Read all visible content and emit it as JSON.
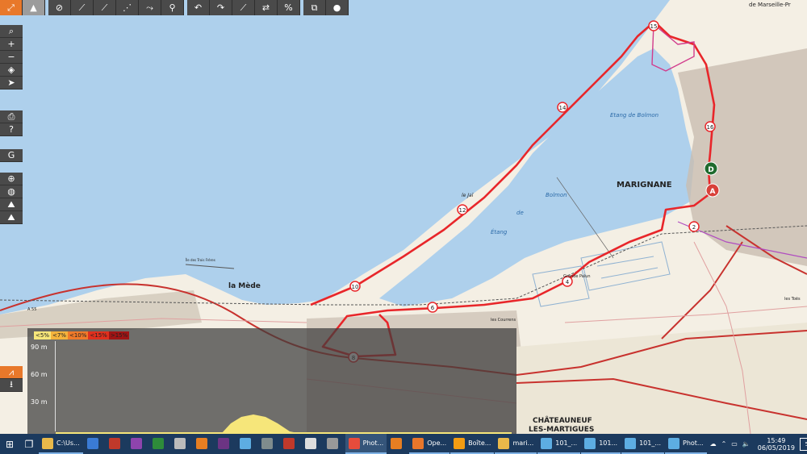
{
  "toolbar": {
    "top_buttons": [
      {
        "name": "fullscreen-icon",
        "glyph": "⤢"
      },
      {
        "name": "map-layer-icon",
        "glyph": "▲"
      },
      {
        "name": "hide-track-icon",
        "glyph": "⊘"
      },
      {
        "name": "draw-line-icon",
        "glyph": "⟋"
      },
      {
        "name": "draw-segment-icon",
        "glyph": "⟋"
      },
      {
        "name": "waypoint-path-icon",
        "glyph": "⋰"
      },
      {
        "name": "route-icon",
        "glyph": "⤳"
      },
      {
        "name": "bike-route-icon",
        "glyph": "⚲"
      },
      {
        "name": "undo-icon",
        "glyph": "↶"
      },
      {
        "name": "redo-icon",
        "glyph": "↷"
      },
      {
        "name": "split-path-icon",
        "glyph": "⟋"
      },
      {
        "name": "reverse-icon",
        "glyph": "⇄"
      },
      {
        "name": "percent-icon",
        "glyph": "%"
      },
      {
        "name": "copy-icon",
        "glyph": "⧉"
      },
      {
        "name": "marker-icon",
        "glyph": "●"
      }
    ],
    "left_groups": [
      [
        {
          "name": "search-icon",
          "glyph": "⌕"
        },
        {
          "name": "zoom-in-icon",
          "glyph": "+"
        },
        {
          "name": "zoom-out-icon",
          "glyph": "−"
        },
        {
          "name": "layers-icon",
          "glyph": "◈"
        },
        {
          "name": "locate-icon",
          "glyph": "➤"
        }
      ],
      [
        {
          "name": "print-icon",
          "glyph": "⎙"
        },
        {
          "name": "help-icon",
          "glyph": "?"
        }
      ],
      [
        {
          "name": "google-icon",
          "glyph": "G"
        }
      ],
      [
        {
          "name": "crosshair-icon",
          "glyph": "⊕"
        },
        {
          "name": "globe-icon",
          "glyph": "◍"
        },
        {
          "name": "terrain-icon",
          "glyph": "⛰"
        },
        {
          "name": "terrain-alt-icon",
          "glyph": "⛰"
        }
      ],
      [
        {
          "name": "elevation-profile-icon",
          "glyph": "⩘"
        },
        {
          "name": "download-icon",
          "glyph": "⭳"
        }
      ]
    ]
  },
  "map": {
    "labels": {
      "marignane": "MARIGNANE",
      "la_mede": "la Mède",
      "chateauneuf_1": "CHÂTEAUNEUF",
      "chateauneuf_2": "LES-MARTIGUES",
      "etang_bolmon_1": "Etang de Bolmon",
      "etang_bolmon_2": "Bolmon",
      "etang_de": "de",
      "etang": "Étang",
      "de_marseille": "de Marseille-Pr",
      "le_jai": "le Jaï",
      "grande_palun": "Grande Palun",
      "courrens": "les Courrens",
      "les_toes": "les Toës",
      "a55": "A 55",
      "ile_trois_freres": "Île des Trois Frères"
    },
    "markers": {
      "start": "D",
      "end": "A"
    },
    "km_markers": [
      "2",
      "4",
      "6",
      "8",
      "10",
      "12",
      "14",
      "15",
      "16"
    ]
  },
  "elevation": {
    "legend": [
      "<5%",
      "<7%",
      "<10%",
      "<15%",
      ">15%"
    ],
    "legend_colors": [
      "#f6e67a",
      "#f4b33c",
      "#f07a2a",
      "#e0301e",
      "#a01414"
    ],
    "y_labels": [
      "90 m",
      "60 m",
      "30 m"
    ]
  },
  "taskbar": {
    "icons": [
      {
        "name": "start-icon",
        "glyph": "⊞"
      },
      {
        "name": "task-view-icon",
        "glyph": "❐"
      }
    ],
    "apps": [
      {
        "name": "explorer-app",
        "label": "C:\\Us...",
        "color": "#e8b84a"
      },
      {
        "name": "store-app",
        "label": "",
        "color": "#3a7bd5"
      },
      {
        "name": "filezilla-app",
        "label": "",
        "color": "#c0392b"
      },
      {
        "name": "nu-app",
        "label": "",
        "color": "#8e44ad"
      },
      {
        "name": "excel-app",
        "label": "",
        "color": "#2e8b3a"
      },
      {
        "name": "folder-app",
        "label": "",
        "color": "#bbb"
      },
      {
        "name": "media-app",
        "label": "",
        "color": "#e67e22"
      },
      {
        "name": "film-app",
        "label": "",
        "color": "#6c3483"
      },
      {
        "name": "network-app",
        "label": "",
        "color": "#5dade2"
      },
      {
        "name": "usb-app",
        "label": "",
        "color": "#7f8c8d"
      },
      {
        "name": "acrobat-app",
        "label": "",
        "color": "#c0392b"
      },
      {
        "name": "settings-app",
        "label": "",
        "color": "#ddd"
      },
      {
        "name": "calculator-app",
        "label": "",
        "color": "#999"
      },
      {
        "name": "photos-app-1",
        "label": "Phot...",
        "color": "#e74c3c"
      },
      {
        "name": "mail-app",
        "label": "",
        "color": "#e67e22"
      },
      {
        "name": "firefox-app",
        "label": "Ope...",
        "color": "#e8762b"
      },
      {
        "name": "mailbox-app",
        "label": "Boîte...",
        "color": "#f39c12"
      },
      {
        "name": "marignane-app",
        "label": "mari...",
        "color": "#e8b84a"
      },
      {
        "name": "image-app-1",
        "label": "101_...",
        "color": "#5dade2"
      },
      {
        "name": "image-app-2",
        "label": "101...",
        "color": "#5dade2"
      },
      {
        "name": "image-app-3",
        "label": "101_...",
        "color": "#5dade2"
      },
      {
        "name": "photos-app-2",
        "label": "Phot...",
        "color": "#5dade2"
      }
    ],
    "clock_time": "15:49",
    "clock_date": "06/05/2019",
    "notification_count": "5"
  }
}
